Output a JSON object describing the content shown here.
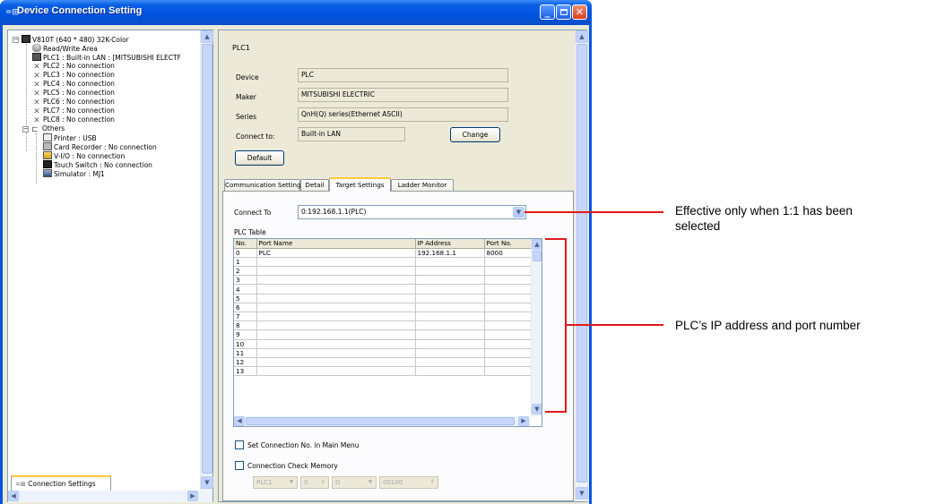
{
  "window": {
    "title": "Device Connection Setting",
    "controls": [
      "minimize",
      "maximize",
      "close"
    ]
  },
  "tree": {
    "root": "V810T (640 * 480) 32K-Color",
    "items": [
      {
        "label": "Read/Write Area",
        "icon": "database-icon"
      },
      {
        "label": "PLC1 : Built-in LAN : [MITSUBISHI ELECTF",
        "icon": "plc-icon"
      },
      {
        "label": "PLC2 : No connection",
        "icon": "x-icon"
      },
      {
        "label": "PLC3 : No connection",
        "icon": "x-icon"
      },
      {
        "label": "PLC4 : No connection",
        "icon": "x-icon"
      },
      {
        "label": "PLC5 : No connection",
        "icon": "x-icon"
      },
      {
        "label": "PLC6 : No connection",
        "icon": "x-icon"
      },
      {
        "label": "PLC7 : No connection",
        "icon": "x-icon"
      },
      {
        "label": "PLC8 : No connection",
        "icon": "x-icon"
      }
    ],
    "others_label": "Others",
    "others_items": [
      {
        "label": "Printer : USB",
        "icon": "printer-icon"
      },
      {
        "label": "Card Recorder : No connection",
        "icon": "card-recorder-icon"
      },
      {
        "label": "V-I/O : No connection",
        "icon": "vio-icon"
      },
      {
        "label": "Touch Switch : No connection",
        "icon": "touch-switch-icon"
      },
      {
        "label": "Simulator : MJ1",
        "icon": "simulator-icon"
      }
    ]
  },
  "bottom_tab": {
    "label": "Connection Settings"
  },
  "panel": {
    "heading": "PLC1",
    "device_label": "Device",
    "device_value": "PLC",
    "maker_label": "Maker",
    "maker_value": "MITSUBISHI ELECTRIC",
    "series_label": "Series",
    "series_value": "QnH(Q) series(Ethernet ASCII)",
    "connect_label": "Connect to:",
    "connect_value": "Built-in LAN",
    "change_button": "Change",
    "default_button": "Default"
  },
  "tabs": [
    {
      "label": "Communication Setting",
      "active": false
    },
    {
      "label": "Detail",
      "active": false
    },
    {
      "label": "Target Settings",
      "active": true
    },
    {
      "label": "Ladder Monitor",
      "active": false
    }
  ],
  "target": {
    "connect_to_label": "Connect To",
    "connect_to_value": "0:192.168.1.1(PLC)",
    "plc_table_label": "PLC Table",
    "columns": [
      "No.",
      "Port Name",
      "IP Address",
      "Port No."
    ],
    "rows": [
      [
        "0",
        "PLC",
        "192.168.1.1",
        "8000"
      ],
      [
        "1",
        "",
        "",
        ""
      ],
      [
        "2",
        "",
        "",
        ""
      ],
      [
        "3",
        "",
        "",
        ""
      ],
      [
        "4",
        "",
        "",
        ""
      ],
      [
        "5",
        "",
        "",
        ""
      ],
      [
        "6",
        "",
        "",
        ""
      ],
      [
        "7",
        "",
        "",
        ""
      ],
      [
        "8",
        "",
        "",
        ""
      ],
      [
        "9",
        "",
        "",
        ""
      ],
      [
        "10",
        "",
        "",
        ""
      ],
      [
        "11",
        "",
        "",
        ""
      ],
      [
        "12",
        "",
        "",
        ""
      ],
      [
        "13",
        "",
        "",
        ""
      ]
    ],
    "set_conn_no_label": "Set Connection No. in Main Menu",
    "conn_check_label": "Connection Check Memory",
    "memory_plc": "PLC1",
    "memory_num": "0",
    "memory_dev": "D",
    "memory_addr": "00100"
  },
  "annotations": {
    "connect_to_note": "Effective only when 1:1 has been selected",
    "connect_to_note_line1": "Effective only when 1:1 has been",
    "connect_to_note_line2": "selected",
    "table_note": "PLC’s IP address and port number",
    "line_color": "#e0191c"
  }
}
